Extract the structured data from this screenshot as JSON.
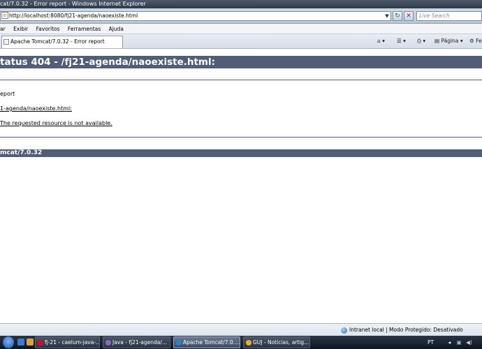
{
  "window": {
    "title": "cat/7.0.32 - Error report - Windows Internet Explorer"
  },
  "address_bar": {
    "url": "http://localhost:8080/fj21-agenda/naoexiste.html",
    "search_placeholder": "Live Search"
  },
  "menu": {
    "items": [
      "ar",
      "Exibir",
      "Favoritos",
      "Ferramentas",
      "Ajuda"
    ]
  },
  "tab": {
    "title": "Apache Tomcat/7.0.32 - Error report"
  },
  "command_bar": {
    "page_label": "Página",
    "fe_label": "Fe"
  },
  "page": {
    "heading": "tatus 404 - /fj21-agenda/naoexiste.html:",
    "line1": "eport",
    "line2": "1-agenda/naoexiste.html:",
    "line3": "The requested resource is not available.",
    "footer": "mcat/7.0.32"
  },
  "status_bar": {
    "zone": "Intranet local | Modo Protegido: Desativado"
  },
  "taskbar": {
    "items": [
      {
        "label": "fj-21 - caelum-java-...",
        "color": "#c8102e"
      },
      {
        "label": "Java - fj21-agenda/...",
        "color": "#8b6bb5"
      },
      {
        "label": "Apache Tomcat/7.0....",
        "color": "#2d7fd8"
      },
      {
        "label": "GUJ - Notícias, artig...",
        "color": "#e8b31a"
      }
    ],
    "tray_lang": "PT"
  }
}
